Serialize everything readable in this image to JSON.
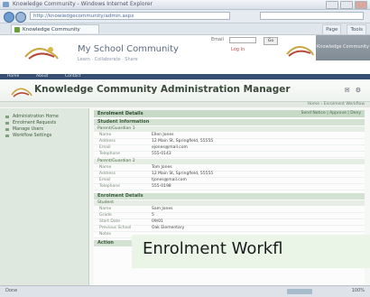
{
  "window": {
    "title": "Knowledge Community - Windows Internet Explorer"
  },
  "browser": {
    "url": "http://knowledgecommunity/admin.aspx",
    "tab": "Knowledge Community",
    "tools": [
      "Page",
      "Tools"
    ]
  },
  "portal": {
    "school_name": "My School Community",
    "school_sub": "Learn · Collaborate · Share",
    "login_label": "Email",
    "login_link": "Log In",
    "go": "Go",
    "badge": "Knowledge Community",
    "strip": [
      "Home",
      "About",
      "Contact"
    ]
  },
  "app": {
    "title": "Knowledge Community Administration Manager",
    "icons": "✉ ⚙",
    "crumb": "Home › Enrolment Workflow"
  },
  "sidebar": {
    "items": [
      "Administration Home",
      "Enrolment Requests",
      "Manage Users",
      "Workflow Settings"
    ]
  },
  "panel": {
    "title": "Enrolment Details",
    "actions": "Send Notice | Approve | Deny"
  },
  "sections": {
    "s1": "Student Information",
    "p1": "Parent/Guardian 1",
    "p1_rows": [
      [
        "Name",
        "Ellen Jones"
      ],
      [
        "Address",
        "12 Main St, Springfield, 55555"
      ],
      [
        "Email",
        "ejones@mail.com"
      ],
      [
        "Telephone",
        "555-0143"
      ]
    ],
    "p2": "Parent/Guardian 2",
    "p2_rows": [
      [
        "Name",
        "Tom Jones"
      ],
      [
        "Address",
        "12 Main St, Springfield, 55555"
      ],
      [
        "Email",
        "tjones@mail.com"
      ],
      [
        "Telephone",
        "555-0198"
      ]
    ],
    "s2": "Enrolment Details",
    "s2_sub": "Student",
    "s2_rows": [
      [
        "Name",
        "Sam Jones"
      ],
      [
        "Grade",
        "5"
      ],
      [
        "Start Date",
        "09/01"
      ],
      [
        "Previous School",
        "Oak Elementary"
      ],
      [
        "Notes",
        ""
      ]
    ],
    "s3": "Action"
  },
  "banner": {
    "text": "Enrolment Workfl"
  },
  "status": {
    "left": "Done",
    "zone": "Internet",
    "zoom": "100%"
  }
}
